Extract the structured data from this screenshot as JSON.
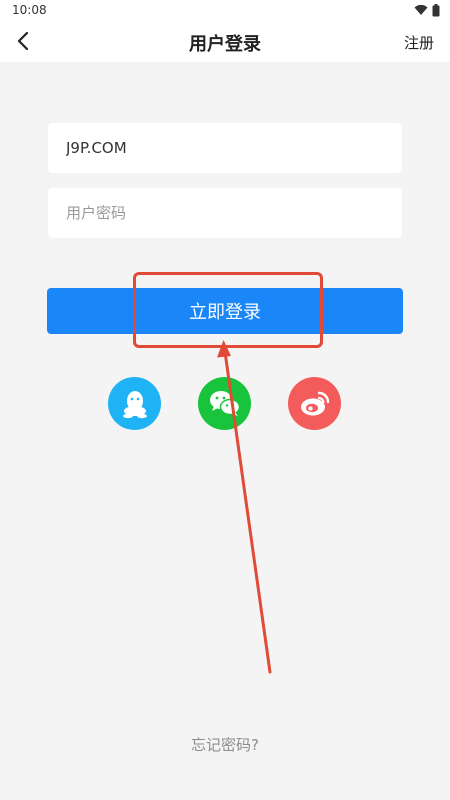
{
  "status_bar": {
    "time": "10:08"
  },
  "nav": {
    "title": "用户登录",
    "register_label": "注册"
  },
  "form": {
    "username_value": "J9P.COM",
    "password_placeholder": "用户密码",
    "login_label": "立即登录"
  },
  "social": {
    "items": [
      {
        "name": "QQ",
        "icon": "qq-icon",
        "color": "#1fb3f5"
      },
      {
        "name": "WeChat",
        "icon": "wechat-icon",
        "color": "#17c43b"
      },
      {
        "name": "Weibo",
        "icon": "weibo-icon",
        "color": "#f45b5b"
      }
    ]
  },
  "forgot_label": "忘记密码?",
  "colors": {
    "primary": "#1a86f7",
    "annotation": "#e04a36",
    "background": "#f4f4f4"
  }
}
